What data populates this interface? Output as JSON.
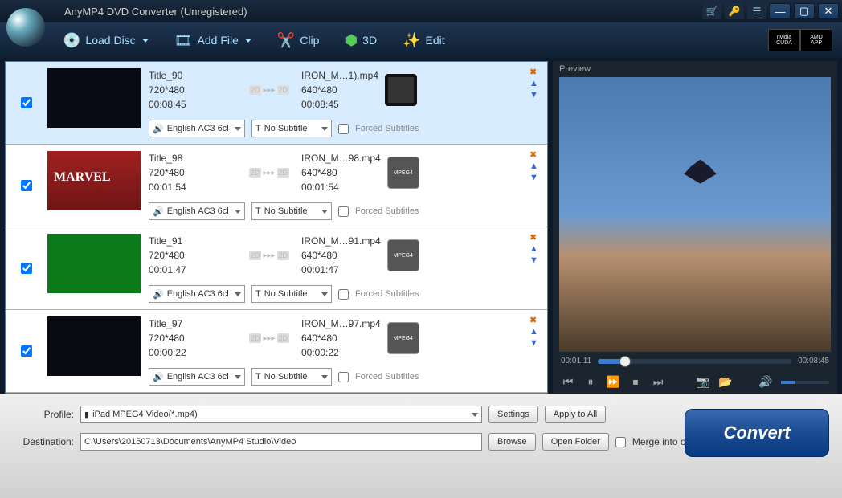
{
  "title": "AnyMP4 DVD Converter (Unregistered)",
  "toolbar": {
    "load_disc": "Load Disc",
    "add_file": "Add File",
    "clip": "Clip",
    "three_d": "3D",
    "edit": "Edit",
    "cuda": "CUDA",
    "amd": "AMD",
    "app": "APP"
  },
  "items": [
    {
      "title": "Title_90",
      "src_res": "720*480",
      "src_dur": "00:08:45",
      "out_name": "IRON_M…1).mp4",
      "out_res": "640*480",
      "out_dur": "00:08:45",
      "audio": "English AC3 6cl",
      "subtitle": "No Subtitle",
      "forced": "Forced Subtitles",
      "device": "ipad",
      "selected": true
    },
    {
      "title": "Title_98",
      "src_res": "720*480",
      "src_dur": "00:01:54",
      "out_name": "IRON_M…98.mp4",
      "out_res": "640*480",
      "out_dur": "00:01:54",
      "audio": "English AC3 6cl",
      "subtitle": "No Subtitle",
      "forced": "Forced Subtitles",
      "device": "mpeg4",
      "selected": false
    },
    {
      "title": "Title_91",
      "src_res": "720*480",
      "src_dur": "00:01:47",
      "out_name": "IRON_M…91.mp4",
      "out_res": "640*480",
      "out_dur": "00:01:47",
      "audio": "English AC3 6cl",
      "subtitle": "No Subtitle",
      "forced": "Forced Subtitles",
      "device": "mpeg4",
      "selected": false
    },
    {
      "title": "Title_97",
      "src_res": "720*480",
      "src_dur": "00:00:22",
      "out_name": "IRON_M…97.mp4",
      "out_res": "640*480",
      "out_dur": "00:00:22",
      "audio": "English AC3 6cl",
      "subtitle": "No Subtitle",
      "forced": "Forced Subtitles",
      "device": "mpeg4",
      "selected": false
    }
  ],
  "preview": {
    "label": "Preview",
    "current": "00:01:11",
    "total": "00:08:45"
  },
  "bottom": {
    "profile_label": "Profile:",
    "profile_value": "iPad MPEG4 Video(*.mp4)",
    "settings": "Settings",
    "apply_all": "Apply to All",
    "dest_label": "Destination:",
    "dest_value": "C:\\Users\\20150713\\Documents\\AnyMP4 Studio\\Video",
    "browse": "Browse",
    "open_folder": "Open Folder",
    "merge": "Merge into one file",
    "convert": "Convert"
  },
  "t2d": "2D"
}
